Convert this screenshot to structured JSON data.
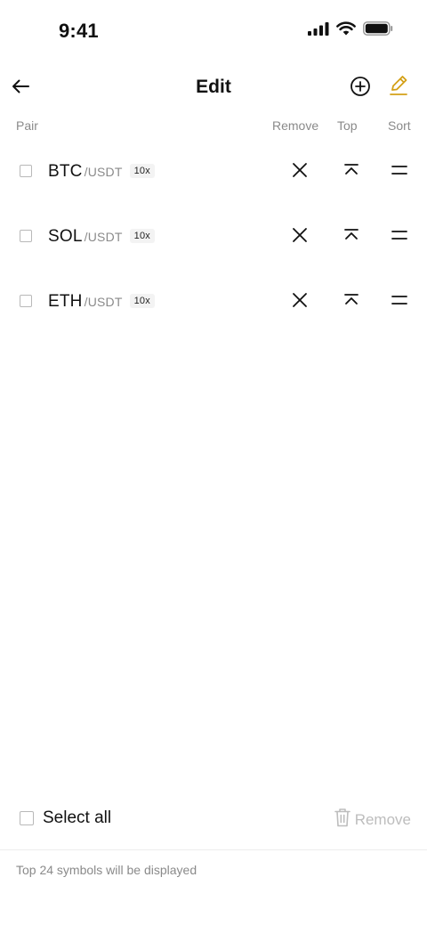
{
  "status_bar": {
    "time": "9:41",
    "icons": [
      "cellular-signal-icon",
      "wifi-icon",
      "battery-icon"
    ]
  },
  "header": {
    "title": "Edit",
    "back_icon": "arrow-left-icon",
    "add_icon": "plus-circle-icon",
    "edit_icon": "pencil-icon"
  },
  "columns": {
    "pair": "Pair",
    "remove": "Remove",
    "top": "Top",
    "sort": "Sort"
  },
  "pairs": [
    {
      "symbol": "BTC",
      "quote": "/USDT",
      "leverage": "10x"
    },
    {
      "symbol": "SOL",
      "quote": "/USDT",
      "leverage": "10x"
    },
    {
      "symbol": "ETH",
      "quote": "/USDT",
      "leverage": "10x"
    }
  ],
  "footer": {
    "select_all": "Select all",
    "remove": "Remove",
    "note": "Top 24 symbols will be displayed"
  },
  "colors": {
    "accent": "#d4a017",
    "text_primary": "#111111",
    "text_secondary": "#8a8a8a",
    "disabled": "#bdbdbd"
  }
}
